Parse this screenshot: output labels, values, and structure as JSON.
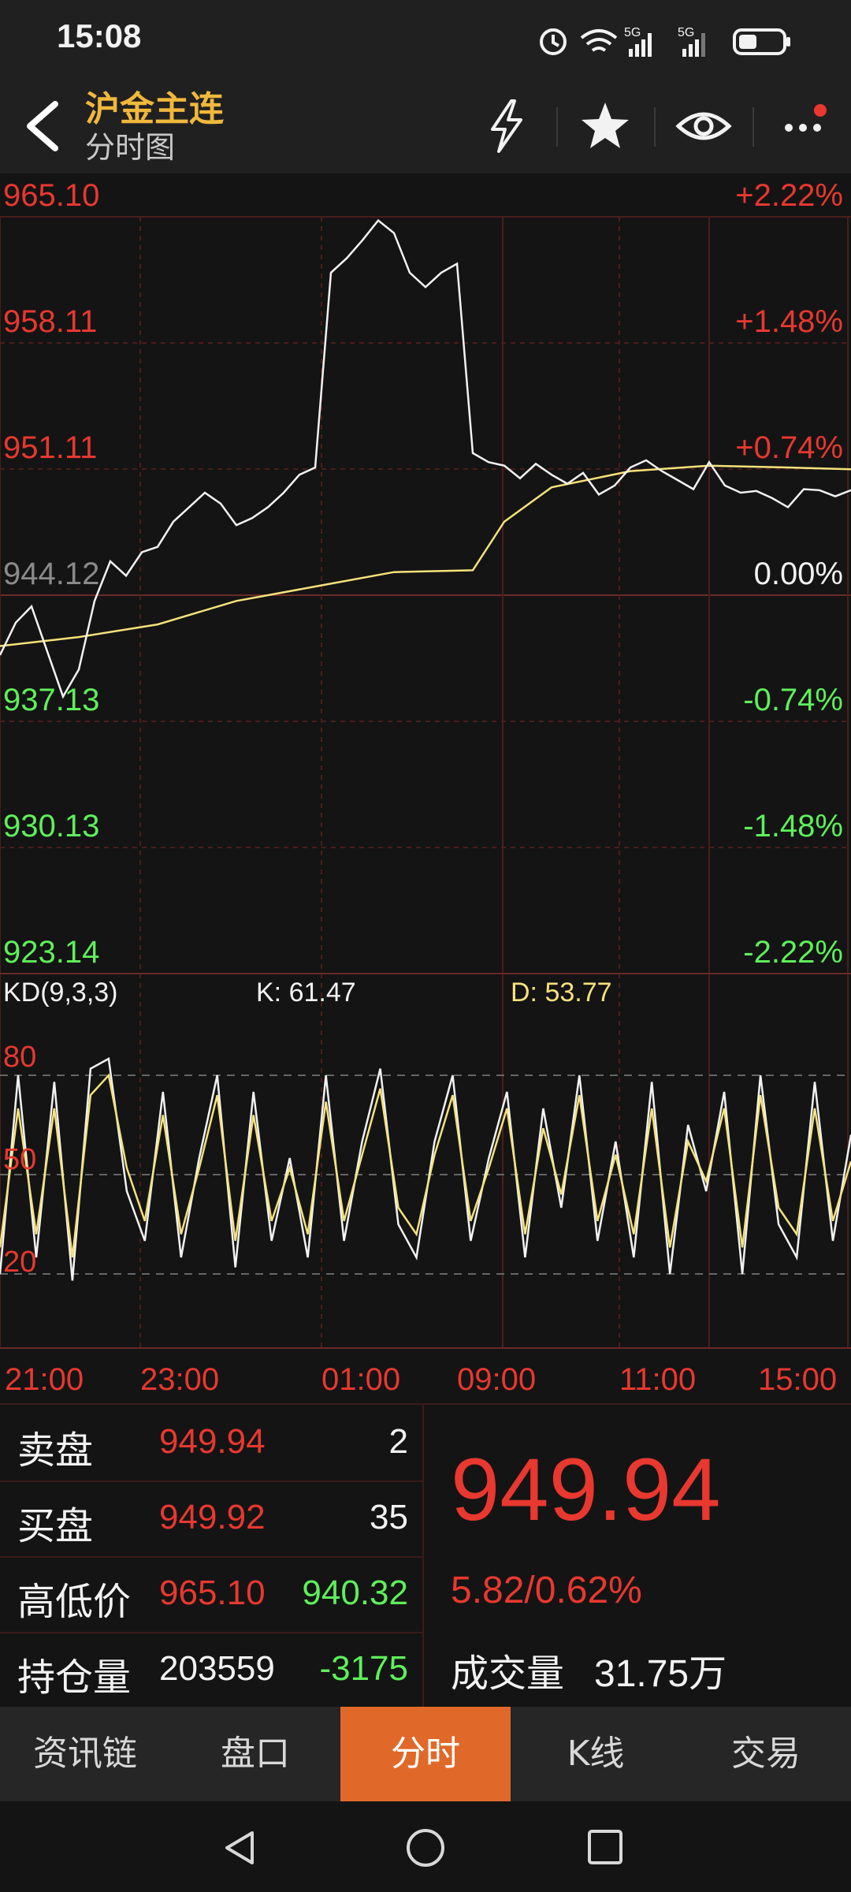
{
  "status": {
    "time": "15:08"
  },
  "header": {
    "title": "沪金主连",
    "subtitle": "分时图"
  },
  "price_axis": {
    "left": [
      "965.10",
      "958.11",
      "951.11",
      "944.12",
      "937.13",
      "930.13",
      "923.14"
    ],
    "right": [
      "+2.22%",
      "+1.48%",
      "+0.74%",
      "0.00%",
      "-0.74%",
      "-1.48%",
      "-2.22%"
    ]
  },
  "kd": {
    "label": "KD(9,3,3)",
    "k": "K: 61.47",
    "d": "D: 53.77",
    "levels": [
      "80",
      "50",
      "20"
    ]
  },
  "time_axis": [
    "21:00",
    "23:00",
    "01:00",
    "09:00",
    "11:00",
    "15:00"
  ],
  "quote": {
    "sell_label": "卖盘",
    "sell_price": "949.94",
    "sell_qty": "2",
    "buy_label": "买盘",
    "buy_price": "949.92",
    "buy_qty": "35",
    "hl_label": "高低价",
    "high": "965.10",
    "low": "940.32",
    "oi_label": "持仓量",
    "oi": "203559",
    "oi_change": "-3175",
    "last": "949.94",
    "change": "5.82/0.62%",
    "vol_label": "成交量",
    "vol": "31.75万"
  },
  "tabs": [
    "资讯链",
    "盘口",
    "分时",
    "K线",
    "交易"
  ],
  "colors": {
    "up": "#e8382f",
    "down": "#5ef05a",
    "accent": "#e0692a",
    "title": "#f0b83c",
    "avg_line": "#f5e27a"
  },
  "chart_data": {
    "type": "line",
    "series": [
      {
        "name": "price",
        "x": [
          0,
          20,
          40,
          60,
          80,
          100,
          120,
          140,
          160,
          180,
          200,
          220,
          240,
          260,
          280,
          300,
          320,
          340,
          360,
          380,
          400,
          420,
          440,
          460,
          480,
          500,
          520,
          540,
          560,
          580,
          600,
          620,
          640,
          660,
          680,
          700,
          720,
          740,
          760,
          780,
          800,
          820,
          840,
          860,
          880,
          900,
          920,
          940,
          960,
          980,
          1000,
          1020,
          1040,
          1060,
          1080
        ],
        "values": [
          940.8,
          942.6,
          943.5,
          941.0,
          938.5,
          940.0,
          943.8,
          946.0,
          945.2,
          946.5,
          946.8,
          948.2,
          949.0,
          949.8,
          949.2,
          948.0,
          948.4,
          949.0,
          949.8,
          950.8,
          951.2,
          962.0,
          962.8,
          963.8,
          964.9,
          964.2,
          962.0,
          961.2,
          962.0,
          962.5,
          952.0,
          951.5,
          951.3,
          950.6,
          951.4,
          950.8,
          950.3,
          950.9,
          949.7,
          950.2,
          951.2,
          951.6,
          951.0,
          950.5,
          950.0,
          951.5,
          950.2,
          949.8,
          949.9,
          949.5,
          949.0,
          950.0,
          949.94,
          949.6,
          949.94
        ]
      },
      {
        "name": "avg",
        "x": [
          0,
          100,
          200,
          300,
          400,
          500,
          600,
          640,
          700,
          800,
          900,
          1000,
          1080
        ],
        "values": [
          941.3,
          941.8,
          942.5,
          943.8,
          944.6,
          945.4,
          945.5,
          948.2,
          950.1,
          951.0,
          951.3,
          951.2,
          951.1
        ]
      }
    ],
    "kd_series": [
      {
        "name": "K",
        "values": [
          20,
          80,
          25,
          78,
          18,
          82,
          85,
          45,
          30,
          75,
          25,
          55,
          80,
          22,
          75,
          30,
          55,
          25,
          80,
          30,
          60,
          82,
          35,
          25,
          60,
          80,
          30,
          55,
          75,
          25,
          70,
          40,
          80,
          30,
          60,
          25,
          78,
          20,
          65,
          45,
          75,
          20,
          80,
          35,
          25,
          78,
          30,
          62
        ]
      },
      {
        "name": "D",
        "values": [
          28,
          70,
          32,
          70,
          25,
          74,
          80,
          52,
          36,
          68,
          32,
          52,
          74,
          30,
          68,
          36,
          52,
          32,
          72,
          36,
          56,
          76,
          40,
          32,
          56,
          74,
          36,
          52,
          70,
          32,
          64,
          44,
          74,
          36,
          56,
          32,
          70,
          28,
          60,
          48,
          70,
          28,
          74,
          40,
          32,
          70,
          36,
          54
        ]
      }
    ],
    "ylim": [
      923.14,
      965.1
    ],
    "kd_levels": [
      80,
      50,
      20
    ]
  }
}
